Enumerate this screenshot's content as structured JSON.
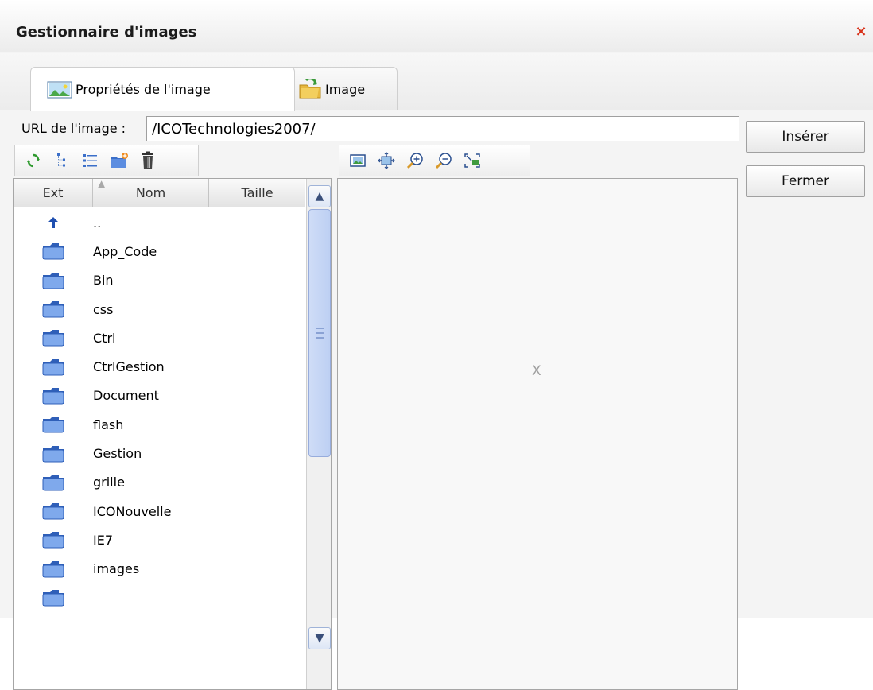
{
  "dialog": {
    "title": "Gestionnaire d'images",
    "close_symbol": "×"
  },
  "tabs": [
    {
      "label": "Propriétés de l'image",
      "icon": "picture-icon",
      "active": true
    },
    {
      "label": "Image",
      "icon": "image-folder-icon",
      "active": false
    }
  ],
  "url": {
    "label": "URL de l'image :",
    "value": "/ICOTechnologies2007/"
  },
  "buttons": {
    "insert": "Insérer",
    "close": "Fermer"
  },
  "file_toolbar": [
    "refresh-icon",
    "tree-view-icon",
    "list-view-icon",
    "new-folder-icon",
    "delete-icon"
  ],
  "preview_toolbar": [
    "fit-image-icon",
    "actual-size-icon",
    "zoom-in-icon",
    "zoom-out-icon",
    "fullscreen-icon"
  ],
  "file_list": {
    "columns": {
      "ext": "Ext",
      "name": "Nom",
      "size": "Taille"
    },
    "rows": [
      {
        "type": "up",
        "name": ".."
      },
      {
        "type": "folder",
        "name": "App_Code"
      },
      {
        "type": "folder",
        "name": "Bin"
      },
      {
        "type": "folder",
        "name": "css"
      },
      {
        "type": "folder",
        "name": "Ctrl"
      },
      {
        "type": "folder",
        "name": "CtrlGestion"
      },
      {
        "type": "folder",
        "name": "Document"
      },
      {
        "type": "folder",
        "name": "flash"
      },
      {
        "type": "folder",
        "name": "Gestion"
      },
      {
        "type": "folder",
        "name": "grille"
      },
      {
        "type": "folder",
        "name": "ICONouvelle"
      },
      {
        "type": "folder",
        "name": "IE7"
      },
      {
        "type": "folder",
        "name": "images"
      }
    ]
  },
  "preview": {
    "placeholder": "X"
  },
  "colors": {
    "accent_close": "#d8331b",
    "folder": "#3b6fc9"
  }
}
